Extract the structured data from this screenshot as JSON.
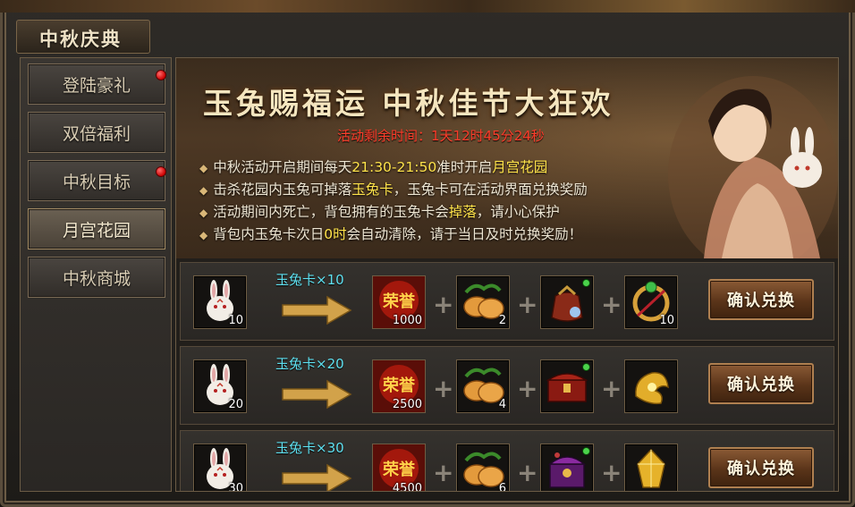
{
  "window": {
    "title": "中秋庆典"
  },
  "sidebar": {
    "items": [
      {
        "label": "登陆豪礼",
        "badge": true,
        "active": false
      },
      {
        "label": "双倍福利",
        "badge": false,
        "active": false
      },
      {
        "label": "中秋目标",
        "badge": true,
        "active": false
      },
      {
        "label": "月宫花园",
        "badge": false,
        "active": true
      },
      {
        "label": "中秋商城",
        "badge": false,
        "active": false
      }
    ]
  },
  "banner": {
    "title": "玉兔赐福运 中秋佳节大狂欢",
    "countdown": "活动剩余时间：1天12时45分24秒",
    "rules": [
      {
        "parts": [
          "中秋活动开启期间每天",
          "21:30-21:50",
          "准时开启",
          "月宫花园",
          ""
        ]
      },
      {
        "parts": [
          "击杀花园内玉兔可掉落",
          "玉兔卡",
          "，玉兔卡可在活动界面兑换奖励",
          "",
          ""
        ]
      },
      {
        "parts": [
          "活动期间内死亡，背包拥有的玉兔卡会",
          "掉落",
          "，请小心保护",
          "",
          ""
        ]
      },
      {
        "parts": [
          "背包内玉兔卡次日",
          "0时",
          "会自动清除，请于当日及时兑换奖励！",
          "",
          ""
        ]
      }
    ]
  },
  "rewards": {
    "confirm_label": "确认兑换",
    "rows": [
      {
        "cost_count": "10",
        "card_label": "玉兔卡×10",
        "honor": "1000",
        "mooncake": "2",
        "item3": "",
        "item4": "10",
        "item3_icon": "pouch-icon",
        "item4_icon": "ring-icon"
      },
      {
        "cost_count": "20",
        "card_label": "玉兔卡×20",
        "honor": "2500",
        "mooncake": "4",
        "item3": "",
        "item4": "",
        "item3_icon": "chest-icon",
        "item4_icon": "golden-wing-icon"
      },
      {
        "cost_count": "30",
        "card_label": "玉兔卡×30",
        "honor": "4500",
        "mooncake": "6",
        "item3": "",
        "item4": "",
        "item3_icon": "purple-chest-icon",
        "item4_icon": "golden-crystal-icon"
      }
    ]
  },
  "icons": {
    "honor_text": "荣誉"
  },
  "colors": {
    "accent_red": "#ff3c2a",
    "highlight_yellow": "#ffe34a",
    "card_cyan": "#5ee0f0"
  }
}
